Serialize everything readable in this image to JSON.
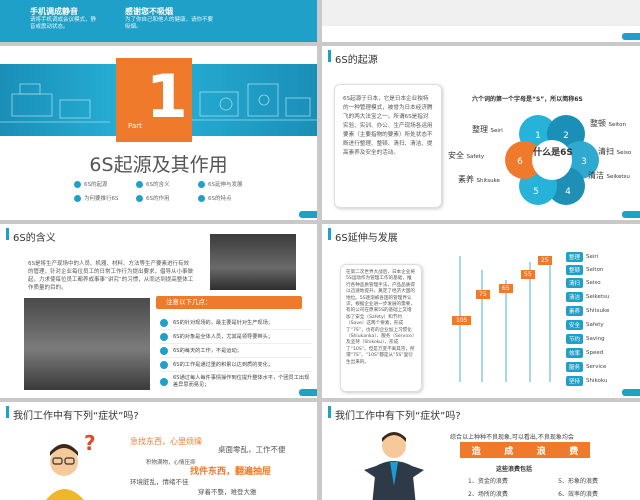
{
  "s1": {
    "left_title": "手机调成静音",
    "left_desc": "请将手机调成会议模式，静音或震动状态。",
    "right_title": "感谢您不吸烟",
    "right_desc": "为了你自己和他人的健康，请你不要吸烟。"
  },
  "s3": {
    "number": "1",
    "part": "Part",
    "title": "6S起源及其作用",
    "items": [
      "6S的起源",
      "6S的含义",
      "6S延伸与发展",
      "为何要推行6S",
      "6S的作用",
      "6S的特点"
    ]
  },
  "s4": {
    "title": "6S的起源",
    "text": "6S起源于日本，它是日本企业独特的一种管理模式，被誉为日本经济腾飞的两大法宝之一。所谓6S是指对实验、实训、办公、生产现场各运用要素（主要指物的要素）所处状态不断进行整理、整顿、清扫、清洁、提高素养及安全的活动。",
    "heading": "六个词的第一个字母是“S”，所以简称6S",
    "center": "什么是6S",
    "words": [
      {
        "cn": "整理",
        "en": "Seiri",
        "n": "1"
      },
      {
        "cn": "整顿",
        "en": "Seiton",
        "n": "2"
      },
      {
        "cn": "清扫",
        "en": "Seiso",
        "n": "3"
      },
      {
        "cn": "清洁",
        "en": "Seiketsu",
        "n": "4"
      },
      {
        "cn": "素养",
        "en": "Shitsuke",
        "n": "5"
      },
      {
        "cn": "安全",
        "en": "Safety",
        "n": "6"
      }
    ]
  },
  "s5": {
    "title": "6S的含义",
    "text": "6S是将生产现场中的人员、机器、材料、方法等生产要素进行有效的管理，针对企业每位员工的日常工作行为提出要求，倡导从小事做起，力求使每位员工都养成事事“讲究”的习惯，从而达到提高整体工作质量的目的。",
    "notice": "注意以下几点：",
    "points": [
      "6S的针对现场的，最主要是针对生产现场；",
      "6S的对象是全体人员，尤其是领导要带头；",
      "6S的每天的工作，不是运动；",
      "6S的工作是通过重的积累以达到质的变化；",
      "6S通过每人每件事情操作到位提升整体水平，个团员工出现差异思而易见；"
    ]
  },
  "s6": {
    "title": "6S延伸与发展",
    "text": "在第二次世界大战后，日本企业将5S运动作为管理工作的基础，推行各种品质管理手法，产品品质得以迅速地提升，奠定了经济大国的地位。5S逐渐被各国的管理界认识。根据企业进一步发展的需要，有的公司在原来5S的基础上又增加了安全（Safety）和节约（Save）这两个要素，形成了“7S”，也有的企业加上习惯化（Shiukanka）、服务（Service）及坚持（Shikoku），形成了“10S”。但是万变不离其宗，所谓“7S”、“10S”都是从“5S”里衍生出来的。",
    "bars": [
      "105",
      "75",
      "65",
      "55",
      "25"
    ],
    "tags": [
      {
        "cn": "整理",
        "en": "Seiri"
      },
      {
        "cn": "整顿",
        "en": "Seiton"
      },
      {
        "cn": "清扫",
        "en": "Seiso"
      },
      {
        "cn": "清洁",
        "en": "Seiketsu"
      },
      {
        "cn": "素养",
        "en": "Shitsuke"
      },
      {
        "cn": "安全",
        "en": "Safety"
      },
      {
        "cn": "节约",
        "en": "Saving"
      },
      {
        "cn": "效率",
        "en": "Speed"
      },
      {
        "cn": "服务",
        "en": "Service"
      },
      {
        "cn": "坚持",
        "en": "Shikoku"
      }
    ]
  },
  "s7": {
    "title": "我们工作中有下列“症状”吗?",
    "phrases": [
      "急找东西，心里烦燥",
      "桌面零乱，工作不便",
      "积物满物，心情压抑",
      "找件东西，翻遍抽屉",
      "环境脏乱，情绪不佳",
      "穿着不整，难登大雅"
    ]
  },
  "s8": {
    "title": "我们工作中有下列“症状”吗?",
    "heading": "综合以上种种不良现象,可以看出,不良现象均会",
    "banner": [
      "造",
      "成",
      "浪",
      "费"
    ],
    "sub": "这些浪费包括",
    "list": [
      "1、资金的浪费",
      "5、形象的浪费",
      "2、场所的浪费",
      "6、效率的浪费"
    ]
  }
}
